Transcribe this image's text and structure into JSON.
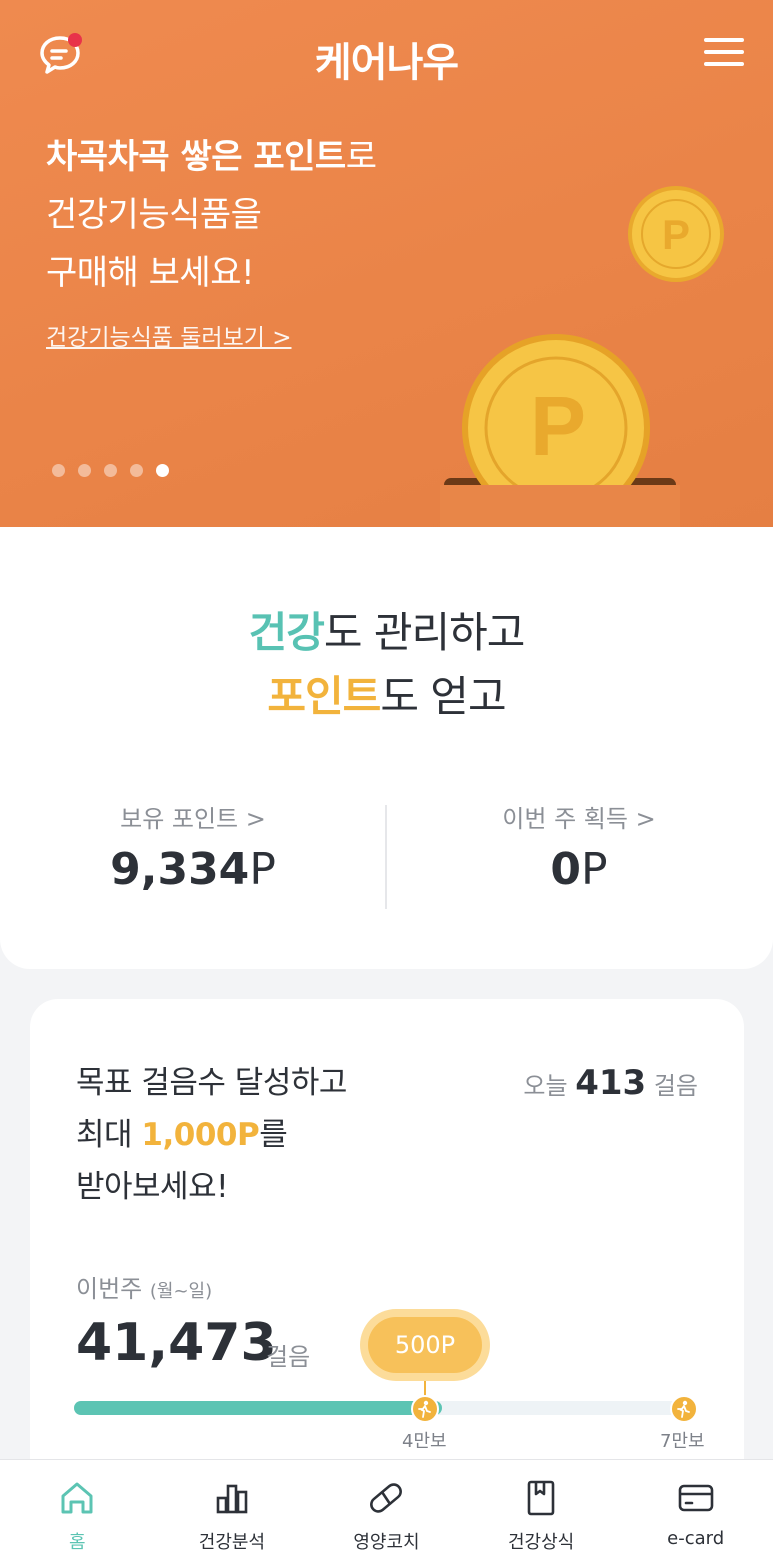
{
  "header": {
    "logo_text": "케어나우",
    "chat_icon": "chat-bubble-icon",
    "menu_icon": "hamburger-menu-icon"
  },
  "banner": {
    "line1_bold": "차곡차곡 쌓은 포인트",
    "line1_rest": "로",
    "line2": "건강기능식품을",
    "line3": "구매해 보세요!",
    "link_text": "건강기능식품 둘러보기 >",
    "slides_total": 5,
    "slide_active": 5,
    "background_color": "#ea8448",
    "coin_letter": "P"
  },
  "points": {
    "tagline_line1_accent": "건강",
    "tagline_line1_rest": "도 관리하고",
    "tagline_line2_accent": "포인트",
    "tagline_line2_rest": "도 얻고",
    "held_label": "보유 포인트 >",
    "held_value": "9,334",
    "held_unit": "P",
    "week_label": "이번 주 획득 >",
    "week_value": "0",
    "week_unit": "P"
  },
  "steps": {
    "goal_line1": "목표 걸음수 달성하고",
    "goal_line2_prefix": "최대 ",
    "goal_line2_highlight": "1,000P",
    "goal_line2_suffix": "를",
    "goal_line3": "받아보세요!",
    "today_label": "오늘",
    "today_value": "413",
    "today_unit": "걸음",
    "week_label": "이번주",
    "week_range": "(월~일)",
    "week_value": "41,473",
    "week_unit": "걸음",
    "reward_badge": "500P",
    "progress_fraction": 0.593,
    "milestone1_label": "4만보",
    "milestone2_label": "7만보"
  },
  "nav": {
    "items": [
      {
        "label": "홈",
        "icon": "home-icon",
        "active": true
      },
      {
        "label": "건강분석",
        "icon": "bar-chart-icon",
        "active": false
      },
      {
        "label": "영양코치",
        "icon": "pill-icon",
        "active": false
      },
      {
        "label": "건강상식",
        "icon": "bookmark-book-icon",
        "active": false
      },
      {
        "label": "e-card",
        "icon": "card-icon",
        "active": false
      }
    ]
  },
  "colors": {
    "accent_green": "#5cc4b3",
    "accent_orange": "#f2b33c",
    "notification_dot": "#e8334a"
  }
}
